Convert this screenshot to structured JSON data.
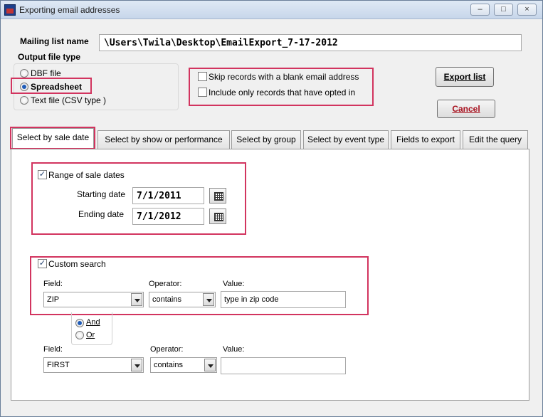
{
  "window": {
    "title": "Exporting email addresses"
  },
  "mailing": {
    "label": "Mailing list name",
    "value": "\\Users\\Twila\\Desktop\\EmailExport_7-17-2012"
  },
  "output": {
    "label": "Output file type",
    "options": [
      "DBF file",
      "Spreadsheet",
      "Text file (CSV type )"
    ],
    "selected": "Spreadsheet"
  },
  "options": {
    "skip_blank": "Skip records with a blank email address",
    "opted_in": "Include only records that have opted in"
  },
  "buttons": {
    "export": "Export list",
    "cancel": "Cancel"
  },
  "tabs": [
    "Select by sale date",
    "Select by show or performance",
    "Select by group",
    "Select by event type",
    "Fields to export",
    "Edit the query"
  ],
  "active_tab": "Select by sale date",
  "sale_dates": {
    "checkbox": "Range of sale dates",
    "checked": true,
    "start_label": "Starting date",
    "start_value": "7/1/2011",
    "end_label": "Ending date",
    "end_value": "7/1/2012"
  },
  "custom_search": {
    "checkbox": "Custom search",
    "checked": true,
    "field_label": "Field:",
    "operator_label": "Operator:",
    "value_label": "Value:",
    "row1": {
      "field": "ZIP",
      "operator": "contains",
      "value": "type in zip code"
    },
    "and_label": "And",
    "or_label": "Or",
    "logic_selected": "And",
    "row2": {
      "field": "FIRST",
      "operator": "contains",
      "value": ""
    }
  }
}
